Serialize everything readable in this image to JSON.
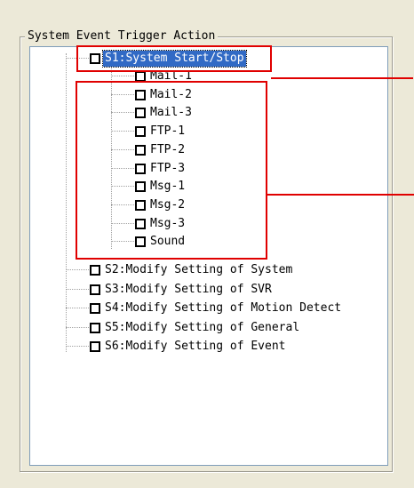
{
  "group": {
    "legend": "System Event Trigger Action"
  },
  "tree": {
    "s1": {
      "label": "S1:System Start/Stop",
      "children": [
        "Mail-1",
        "Mail-2",
        "Mail-3",
        "FTP-1",
        "FTP-2",
        "FTP-3",
        "Msg-1",
        "Msg-2",
        "Msg-3",
        "Sound"
      ]
    },
    "others": [
      "S2:Modify Setting of System",
      "S3:Modify Setting of SVR",
      "S4:Modify Setting of Motion Detect",
      "S5:Modify Setting of General",
      "S6:Modify Setting of Event"
    ]
  },
  "colors": {
    "selection": "#316ac5",
    "annotation": "#e00000"
  }
}
